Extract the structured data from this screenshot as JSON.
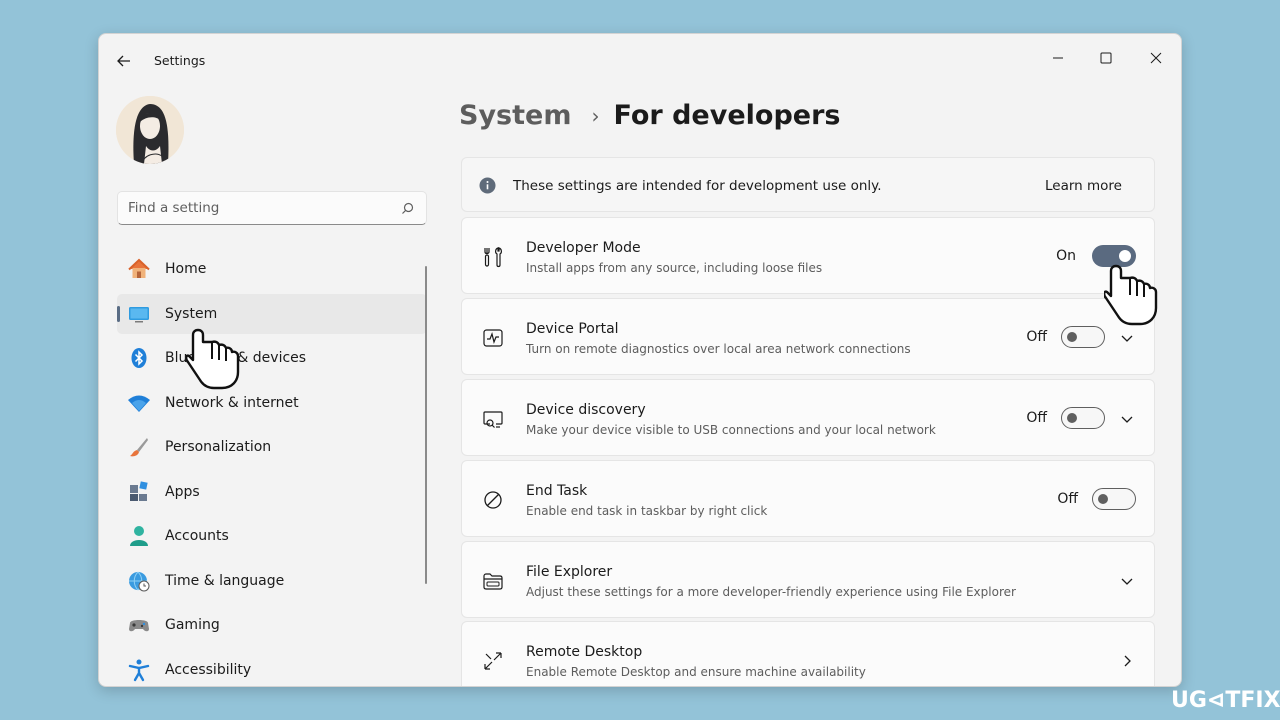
{
  "window": {
    "title": "Settings",
    "controls": [
      "minimize-icon",
      "maximize-icon",
      "close-icon"
    ]
  },
  "search": {
    "placeholder": "Find a setting"
  },
  "nav": {
    "items": [
      {
        "label": "Home",
        "icon": "home-icon"
      },
      {
        "label": "System",
        "icon": "monitor-icon",
        "selected": true
      },
      {
        "label": "Bluetooth & devices",
        "icon": "bluetooth-icon"
      },
      {
        "label": "Network & internet",
        "icon": "wifi-icon"
      },
      {
        "label": "Personalization",
        "icon": "paintbrush-icon"
      },
      {
        "label": "Apps",
        "icon": "apps-icon"
      },
      {
        "label": "Accounts",
        "icon": "person-icon"
      },
      {
        "label": "Time & language",
        "icon": "globe-clock-icon"
      },
      {
        "label": "Gaming",
        "icon": "gamepad-icon"
      },
      {
        "label": "Accessibility",
        "icon": "accessibility-icon"
      }
    ]
  },
  "breadcrumb": {
    "parent": "System",
    "separator": "›",
    "current": "For developers"
  },
  "info": {
    "text": "These settings are intended for development use only.",
    "link": "Learn more"
  },
  "settings": [
    {
      "title": "Developer Mode",
      "desc": "Install apps from any source, including loose files",
      "state": "On",
      "toggle": true,
      "chevron": "none",
      "icon": "developer-tools-icon"
    },
    {
      "title": "Device Portal",
      "desc": "Turn on remote diagnostics over local area network connections",
      "state": "Off",
      "toggle": false,
      "chevron": "down",
      "icon": "pulse-icon"
    },
    {
      "title": "Device discovery",
      "desc": "Make your device visible to USB connections and your local network",
      "state": "Off",
      "toggle": false,
      "chevron": "down",
      "icon": "device-search-icon"
    },
    {
      "title": "End Task",
      "desc": "Enable end task in taskbar by right click",
      "state": "Off",
      "toggle": false,
      "chevron": "none",
      "icon": "prohibited-icon"
    },
    {
      "title": "File Explorer",
      "desc": "Adjust these settings for a more developer-friendly experience using File Explorer",
      "chevron": "down",
      "icon": "folder-icon"
    },
    {
      "title": "Remote Desktop",
      "desc": "Enable Remote Desktop and ensure machine availability",
      "chevron": "right",
      "icon": "remote-desktop-icon"
    }
  ],
  "watermark": "UG⊲TFIX",
  "colors": {
    "accent": "#5a6a80",
    "background": "#93c3d8",
    "window": "#f3f3f3",
    "card": "#fbfbfb"
  }
}
